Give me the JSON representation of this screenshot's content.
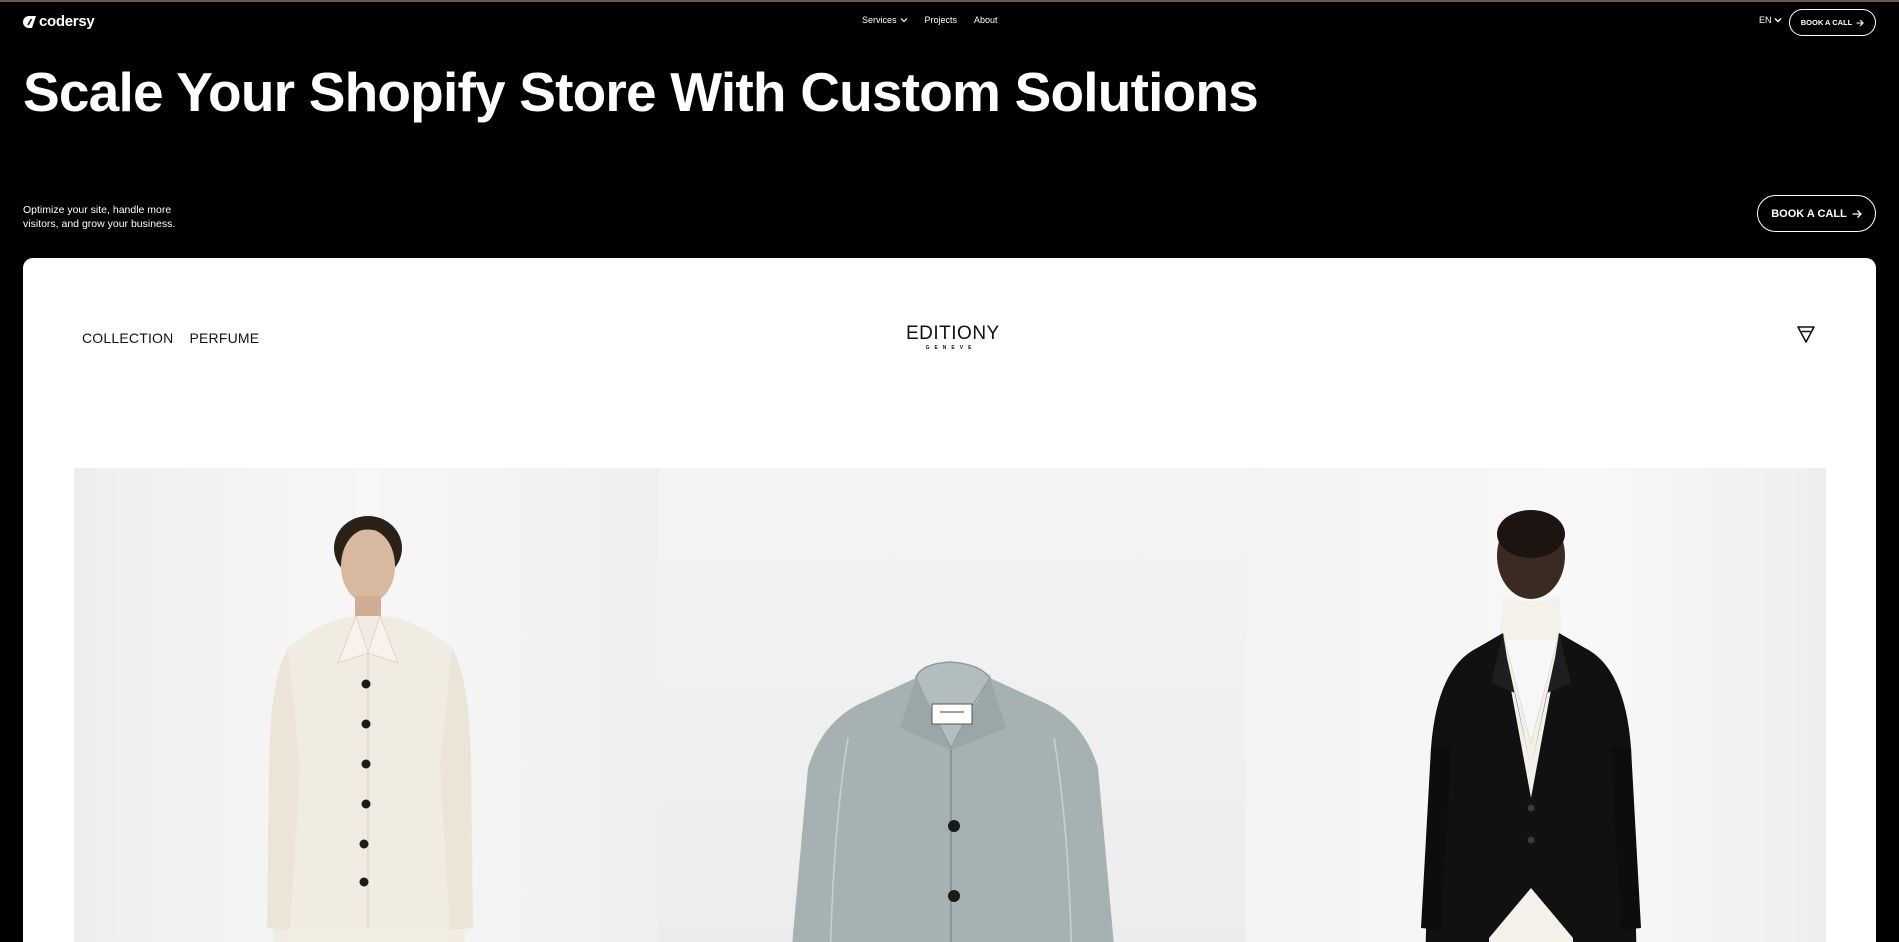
{
  "nav": {
    "logo_text": "codersy",
    "links": [
      {
        "label": "Services",
        "has_dropdown": true
      },
      {
        "label": "Projects",
        "has_dropdown": false
      },
      {
        "label": "About",
        "has_dropdown": false
      }
    ],
    "language": "EN",
    "cta_label": "BOOK A CALL"
  },
  "hero": {
    "title": "Scale Your Shopify Store With Custom Solutions",
    "subtitle": "Optimize your site, handle more visitors, and grow your business.",
    "cta_label": "BOOK A CALL"
  },
  "showcase": {
    "nav_items": [
      "COLLECTION",
      "PERFUME"
    ],
    "brand_name": "EDITIONY",
    "brand_sub": "GENEVE",
    "images": [
      {
        "icon": "model-cream-jacket-image"
      },
      {
        "icon": "grey-coat-image"
      },
      {
        "icon": "model-black-blazer-image"
      }
    ]
  },
  "colors": {
    "background": "#000000",
    "card": "#ffffff",
    "text": "#ffffff"
  }
}
